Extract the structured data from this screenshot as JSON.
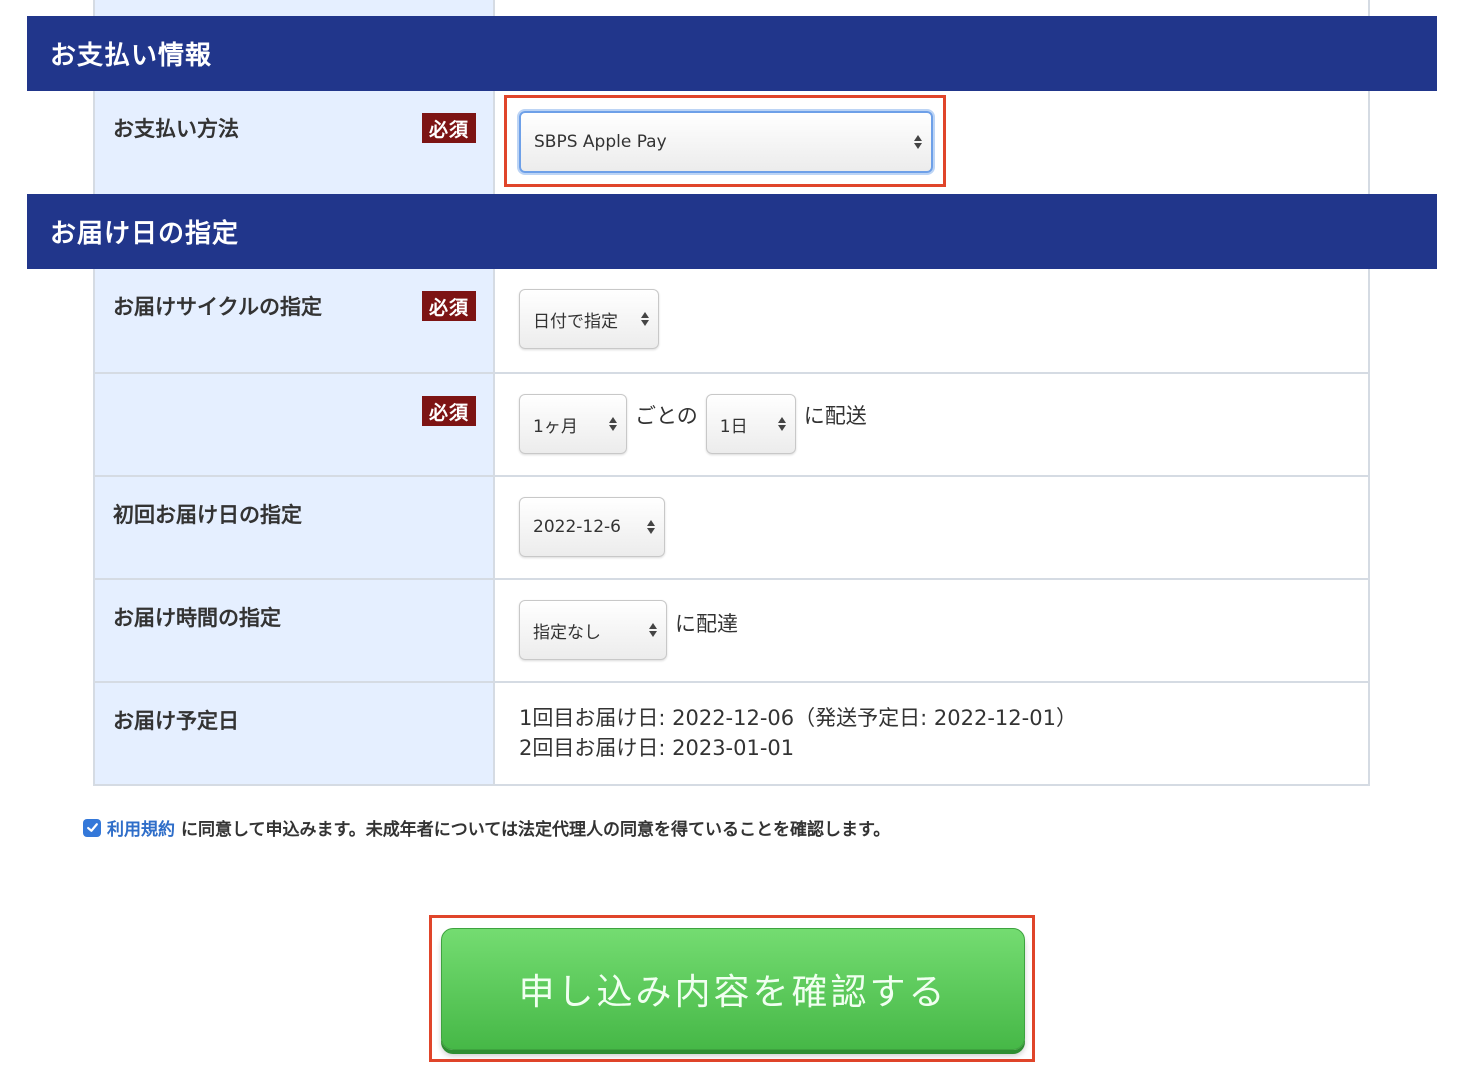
{
  "payment_section": {
    "title": "お支払い情報",
    "method_label": "お支払い方法",
    "required_badge": "必須",
    "method_value": "SBPS Apple Pay"
  },
  "delivery_section": {
    "title": "お届け日の指定",
    "cycle": {
      "label": "お届けサイクルの指定",
      "required_badge": "必須",
      "value": "日付で指定"
    },
    "interval": {
      "required_badge": "必須",
      "months_value": "1ヶ月",
      "between_text": "ごとの",
      "day_value": "1日",
      "suffix_text": "に配送"
    },
    "first_date": {
      "label": "初回お届け日の指定",
      "value": "2022-12-6"
    },
    "time": {
      "label": "お届け時間の指定",
      "value": "指定なし",
      "suffix_text": "に配達"
    },
    "scheduled": {
      "label": "お届け予定日",
      "line1": "1回目お届け日: 2022-12-06（発送予定日: 2022-12-01）",
      "line2": "2回目お届け日: 2023-01-01"
    }
  },
  "agreement": {
    "checked": true,
    "terms_link": "利用規約",
    "text": "に同意して申込みます。未成年者については法定代理人の同意を得ていることを確認します。"
  },
  "confirm_button": {
    "label": "申し込み内容を確認する"
  },
  "colors": {
    "section_header_bg": "#21368b",
    "label_cell_bg": "#e5efff",
    "required_badge_bg": "#7d1414",
    "highlight_box": "#e0452a",
    "button_green": "#46b847",
    "link_blue": "#2f6ec9"
  }
}
